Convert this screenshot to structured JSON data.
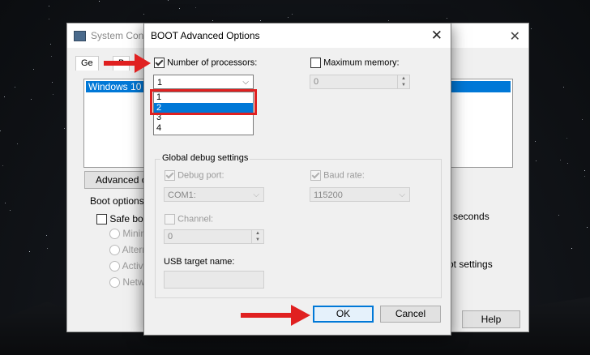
{
  "background_window": {
    "title": "System Conf",
    "tab_general": "Ge",
    "tab_boot": "B",
    "boot_entry": "Windows 10 (C",
    "advanced_button": "Advanced op",
    "boot_options_label": "Boot options",
    "safe_boot_label": "Safe boo",
    "radio_minimal": "Minim",
    "radio_alternate": "Altern",
    "radio_active": "Active",
    "radio_network": "Netw",
    "seconds_label": "seconds",
    "boot_settings_label": "ot settings",
    "help_button": "Help"
  },
  "dialog": {
    "title": "BOOT Advanced Options",
    "num_processors": {
      "label": "Number of processors:",
      "checked": true,
      "value": "1",
      "options": [
        "1",
        "2",
        "3",
        "4"
      ],
      "highlighted": "2"
    },
    "max_memory": {
      "label": "Maximum memory:",
      "checked": false,
      "value": "0"
    },
    "debug_group_title": "Global debug settings",
    "debug_port": {
      "label": "Debug port:",
      "checked": true,
      "value": "COM1:"
    },
    "baud_rate": {
      "label": "Baud rate:",
      "checked": true,
      "value": "115200"
    },
    "channel": {
      "label": "Channel:",
      "checked": false,
      "value": "0"
    },
    "usb_target_label": "USB target name:",
    "ok_button": "OK",
    "cancel_button": "Cancel"
  },
  "annotation_color": "#e02020",
  "selection_color": "#0078d7"
}
